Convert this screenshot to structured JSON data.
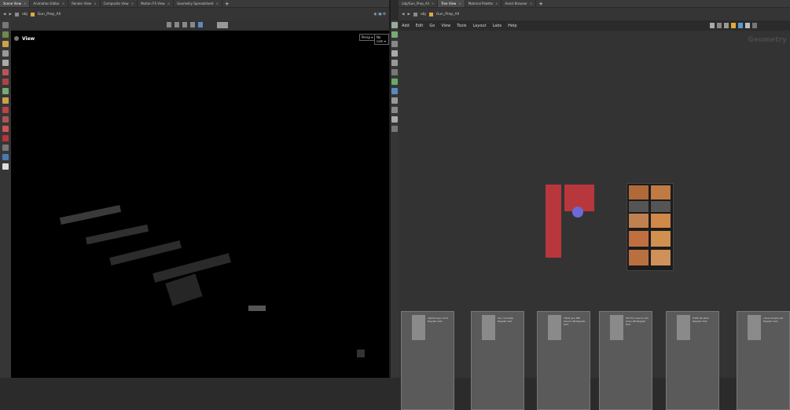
{
  "left_tabs": [
    "Scene View",
    "Animation Editor",
    "Render View",
    "Composite View",
    "Motion FX View",
    "Geometry Spreadsheet"
  ],
  "left_path": {
    "obj": "obj",
    "node": "Gun_Prep_All"
  },
  "viewport": {
    "title": "View",
    "persp": "Persp ▾",
    "cam": "No cam ▾"
  },
  "right_tabs": [
    "/obj/Gun_Prep_All",
    "Tree View",
    "Material Palette",
    "Asset Browser"
  ],
  "right_path": {
    "obj": "obj",
    "node": "Gun_Prep_All"
  },
  "menu": [
    "Add",
    "Edit",
    "Go",
    "View",
    "Tools",
    "Layout",
    "Labs",
    "Help"
  ],
  "network_label": "Geometry",
  "cards": [
    {
      "label": "stylized gun mod\nRegular text"
    },
    {
      "label": "Gun cen-step\nRegular text"
    },
    {
      "label": "Tilted gun Mlll (Gunn) SB\nRegular text"
    },
    {
      "label": "ISS Fun Launch (All GoG) GB\nRegular text"
    },
    {
      "label": "Fulfill all steel\nRegular text"
    },
    {
      "label": "visual Limple set\nRegular text"
    }
  ]
}
